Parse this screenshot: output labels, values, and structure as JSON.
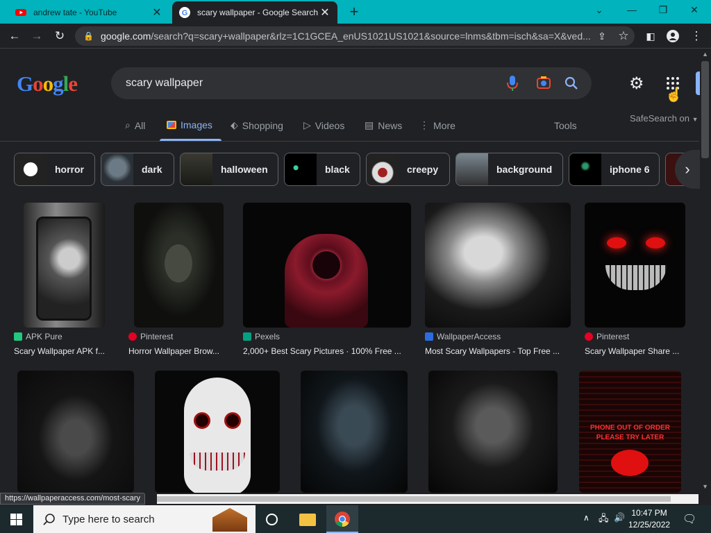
{
  "tabs": [
    {
      "title": "andrew tate - YouTube"
    },
    {
      "title": "scary wallpaper - Google Search"
    }
  ],
  "address": {
    "domain": "google.com",
    "path": "/search?q=scary+wallpaper&rlz=1C1GCEA_enUS1021US1021&source=lnms&tbm=isch&sa=X&ved..."
  },
  "search": {
    "query": "scary wallpaper"
  },
  "logo": {
    "letters": [
      "G",
      "o",
      "o",
      "g",
      "l",
      "e"
    ]
  },
  "nav": {
    "all": "All",
    "images": "Images",
    "shopping": "Shopping",
    "videos": "Videos",
    "news": "News",
    "more": "More",
    "tools": "Tools",
    "safesearch": "SafeSearch on"
  },
  "chips": [
    "horror",
    "dark",
    "halloween",
    "black",
    "creepy",
    "background",
    "iphone 6"
  ],
  "results_row1": [
    {
      "source": "APK Pure",
      "caption": "Scary Wallpaper APK f..."
    },
    {
      "source": "Pinterest",
      "caption": "Horror Wallpaper Brow..."
    },
    {
      "source": "Pexels",
      "caption": "2,000+ Best Scary Pictures · 100% Free ..."
    },
    {
      "source": "WallpaperAccess",
      "caption": "Most Scary Wallpapers - Top Free ..."
    },
    {
      "source": "Pinterest",
      "caption": "Scary Wallpaper Share ..."
    }
  ],
  "image_texts": {
    "phone_text_1": "PHONE OUT OF ORDER",
    "phone_text_2": "PLEASE TRY LATER"
  },
  "status_url": "https://wallpaperaccess.com/most-scary",
  "taskbar": {
    "search_placeholder": "Type here to search",
    "time": "10:47 PM",
    "date": "12/25/2022"
  },
  "colors": {
    "titlebar": "#00b3bc",
    "page_bg": "#202124",
    "accent": "#8ab4f8"
  }
}
